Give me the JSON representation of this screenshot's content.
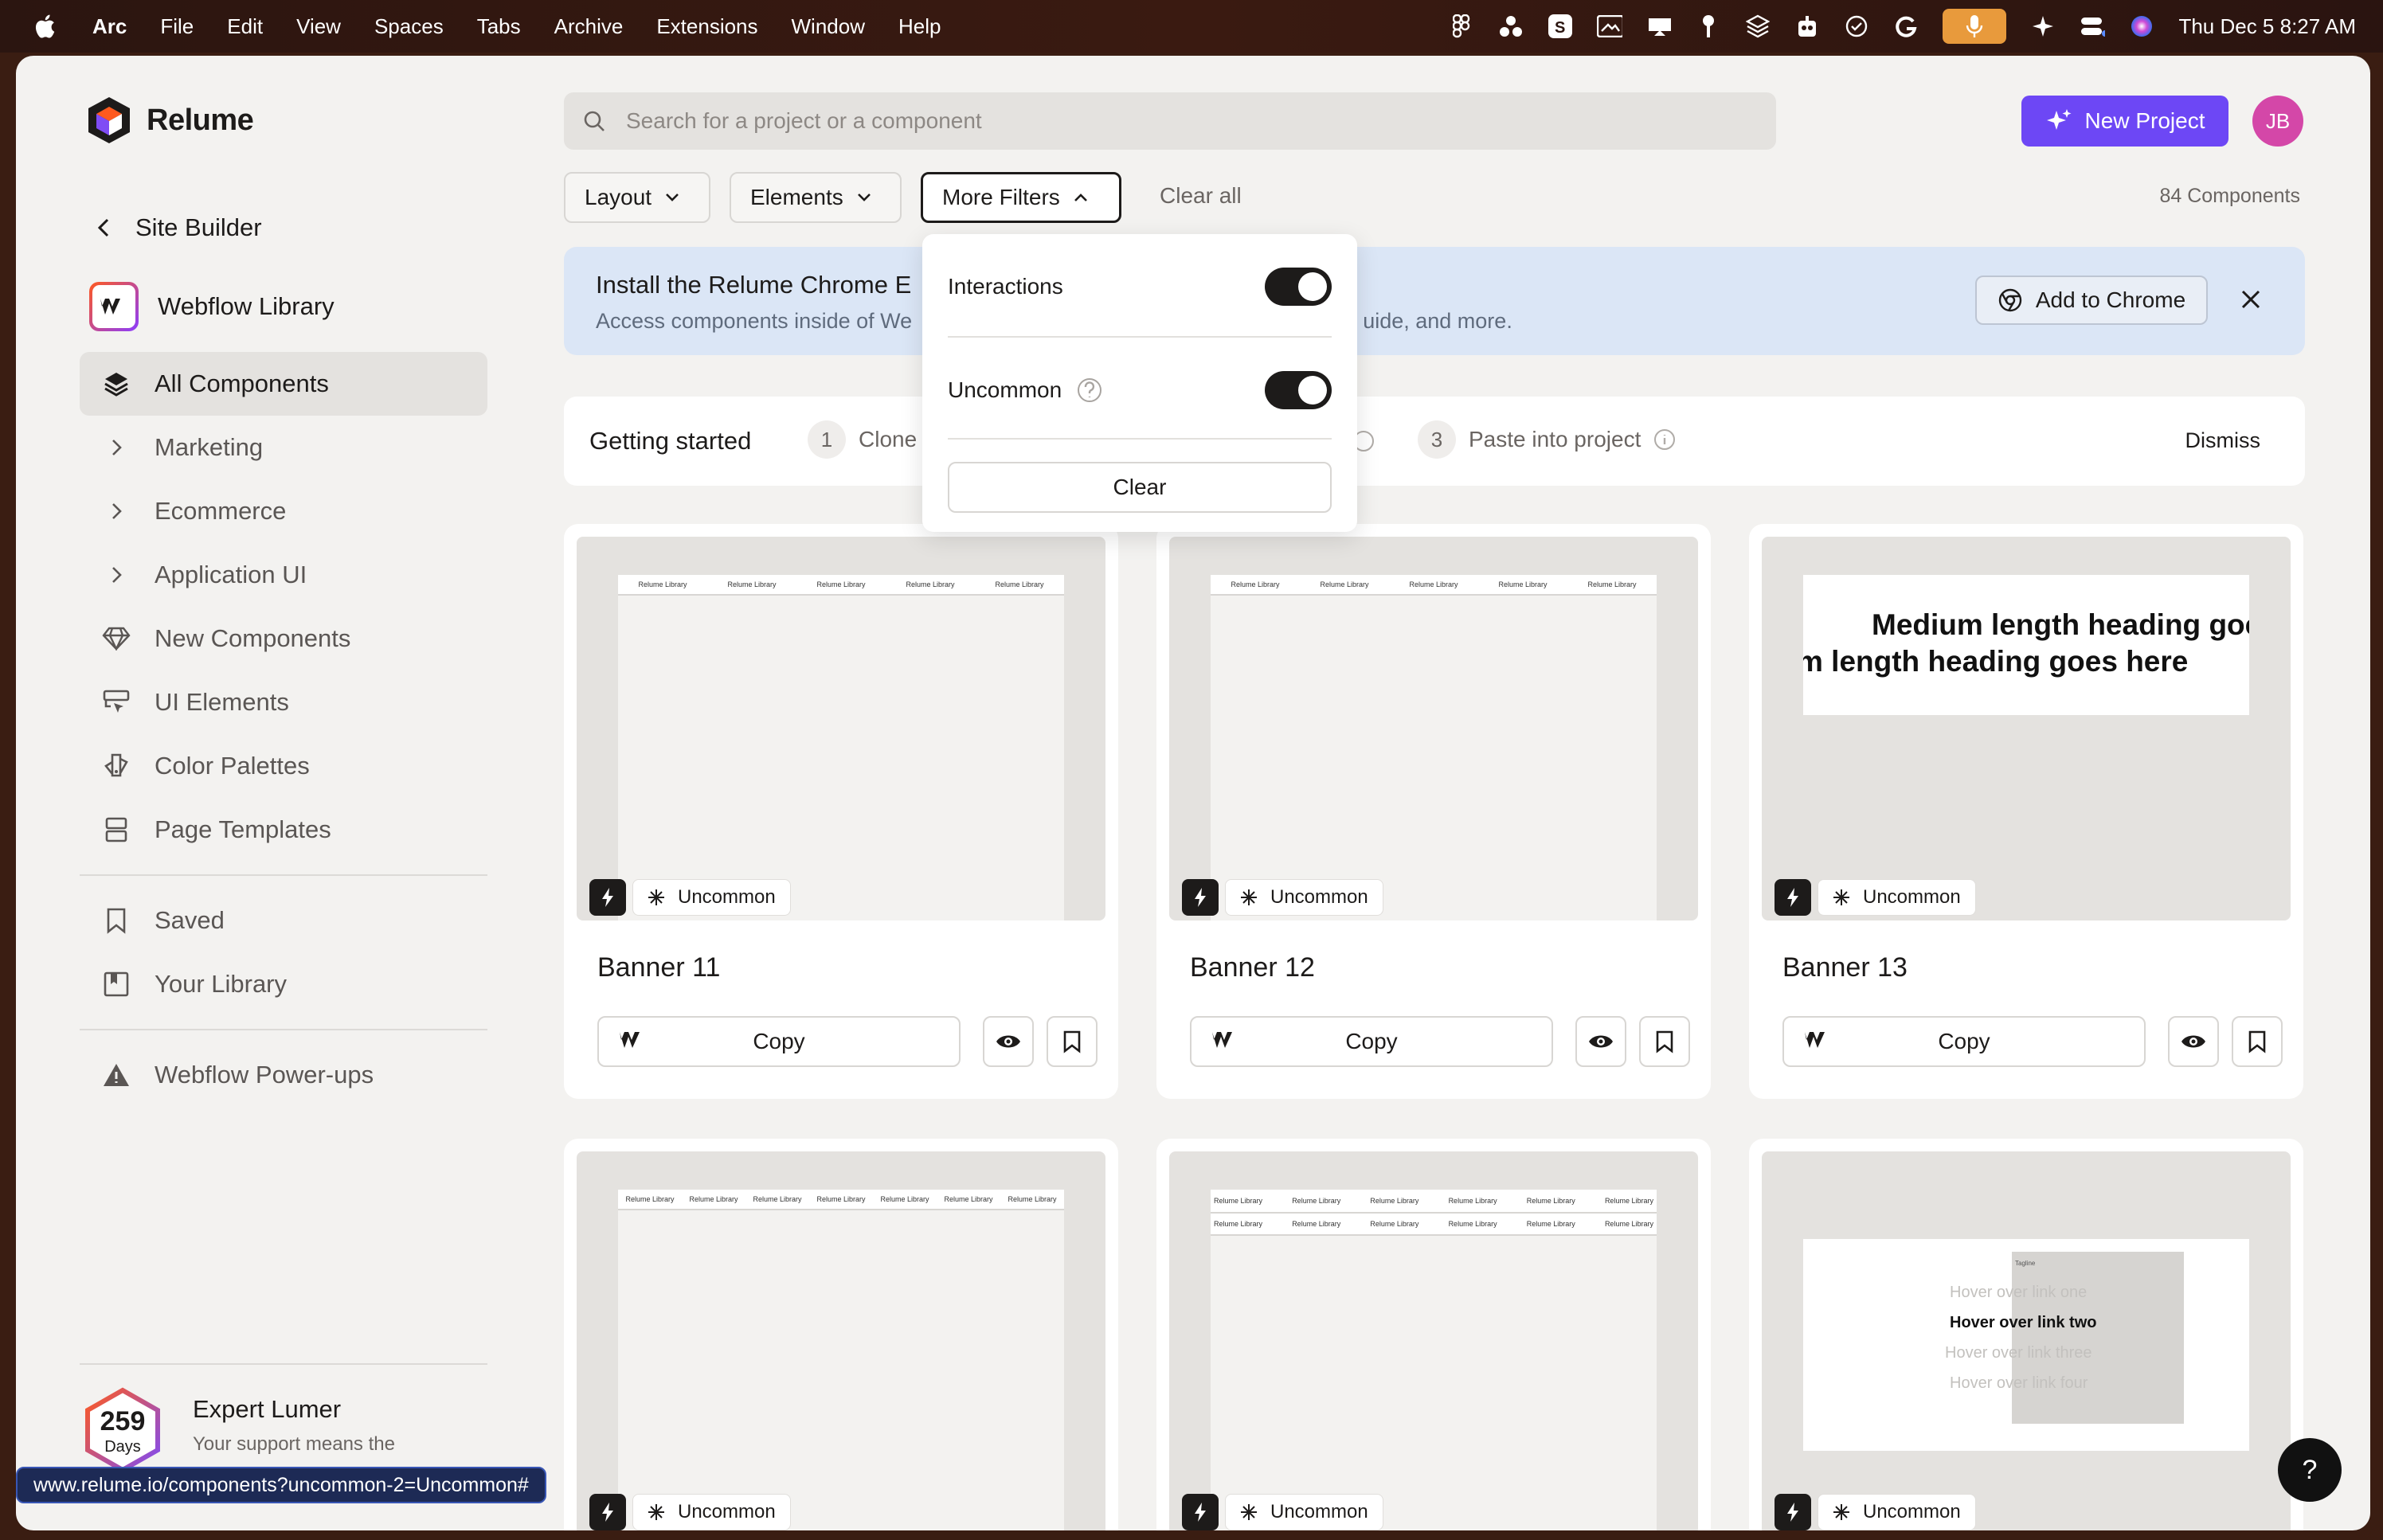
{
  "menubar": {
    "app": "Arc",
    "items": [
      "File",
      "Edit",
      "View",
      "Spaces",
      "Tabs",
      "Archive",
      "Extensions",
      "Window",
      "Help"
    ],
    "clock": "Thu Dec 5  8:27 AM"
  },
  "sidebar": {
    "brand": "Relume",
    "back_label": "Site Builder",
    "library": "Webflow Library",
    "items": [
      {
        "label": "All Components",
        "icon": "layers-icon"
      },
      {
        "label": "Marketing",
        "icon": "chevron-right-icon"
      },
      {
        "label": "Ecommerce",
        "icon": "chevron-right-icon"
      },
      {
        "label": "Application UI",
        "icon": "chevron-right-icon"
      },
      {
        "label": "New Components",
        "icon": "gem-icon"
      },
      {
        "label": "UI Elements",
        "icon": "ui-elements-icon"
      },
      {
        "label": "Color Palettes",
        "icon": "palette-icon"
      },
      {
        "label": "Page Templates",
        "icon": "template-icon"
      }
    ],
    "saved": "Saved",
    "your_library": "Your Library",
    "powerups": "Webflow Power-ups",
    "lumer": {
      "days": "259",
      "days_label": "Days",
      "title": "Expert Lumer",
      "subtitle": "Your support means the"
    }
  },
  "status_url": "www.relume.io/components?uncommon-2=Uncommon#",
  "search": {
    "placeholder": "Search for a project or a component"
  },
  "header": {
    "new_project": "New Project",
    "avatar": "JB"
  },
  "filters": {
    "layout": "Layout",
    "elements": "Elements",
    "more": "More Filters",
    "clear_all": "Clear all",
    "count": "84 Components"
  },
  "dropdown": {
    "interactions": "Interactions",
    "uncommon": "Uncommon",
    "clear": "Clear"
  },
  "banner": {
    "title": "Install the Relume Chrome E",
    "subtitle_start": "Access components inside of We",
    "subtitle_end": "uide, and more.",
    "button": "Add to Chrome"
  },
  "getting_started": {
    "title": "Getting started",
    "step1_num": "1",
    "step1": "Clone",
    "step3_num": "3",
    "step3": "Paste into project",
    "dismiss": "Dismiss"
  },
  "cards": [
    {
      "title": "Banner 11",
      "tag": "Uncommon",
      "copy": "Copy"
    },
    {
      "title": "Banner 12",
      "tag": "Uncommon",
      "copy": "Copy"
    },
    {
      "title": "Banner 13",
      "tag": "Uncommon",
      "copy": "Copy"
    },
    {
      "title": "",
      "tag": "Uncommon",
      "copy": ""
    },
    {
      "title": "",
      "tag": "Uncommon",
      "copy": ""
    },
    {
      "title": "",
      "tag": "Uncommon",
      "copy": ""
    }
  ],
  "previews": {
    "nav_item": "Relume Library",
    "heading_line1": "Medium length heading goes",
    "heading_line2": "m length heading goes here",
    "tagline": "Tagline",
    "hover_links": [
      "Hover over link one",
      "Hover over link two",
      "Hover over link three",
      "Hover over link four"
    ]
  },
  "help": "?"
}
